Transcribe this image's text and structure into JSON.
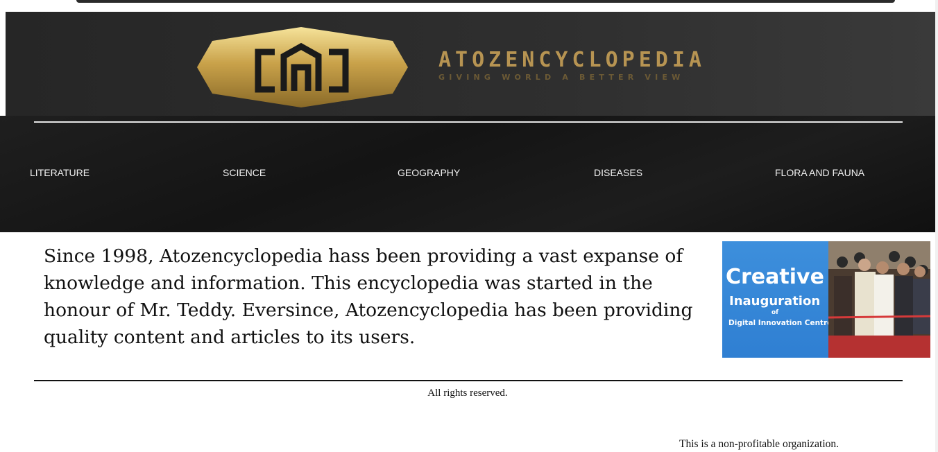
{
  "header": {
    "logo_icon": "atoz-monogram-icon",
    "title": "ATOZENCYCLOPEDIA",
    "tagline": "GIVING WORLD A BETTER VIEW",
    "accent_color": "#b79452"
  },
  "nav": {
    "items": [
      {
        "label": "LITERATURE"
      },
      {
        "label": "SCIENCE"
      },
      {
        "label": "GEOGRAPHY"
      },
      {
        "label": "DISEASES"
      },
      {
        "label": "FLORA AND FAUNA"
      }
    ]
  },
  "main": {
    "intro": "Since 1998, Atozencyclopedia hass been providing a vast expanse of knowledge and information. This encyclopedia was started in the honour of Mr. Teddy. Eversince, Atozencyclopedia has been providing quality content and articles to its users."
  },
  "banner": {
    "line1": "Creative",
    "line2": "Inauguration",
    "line3": "of",
    "line4": "Digital Innovation Centre"
  },
  "footer": {
    "rights": "All rights reserved.",
    "note": "This is a non-profitable organization."
  }
}
